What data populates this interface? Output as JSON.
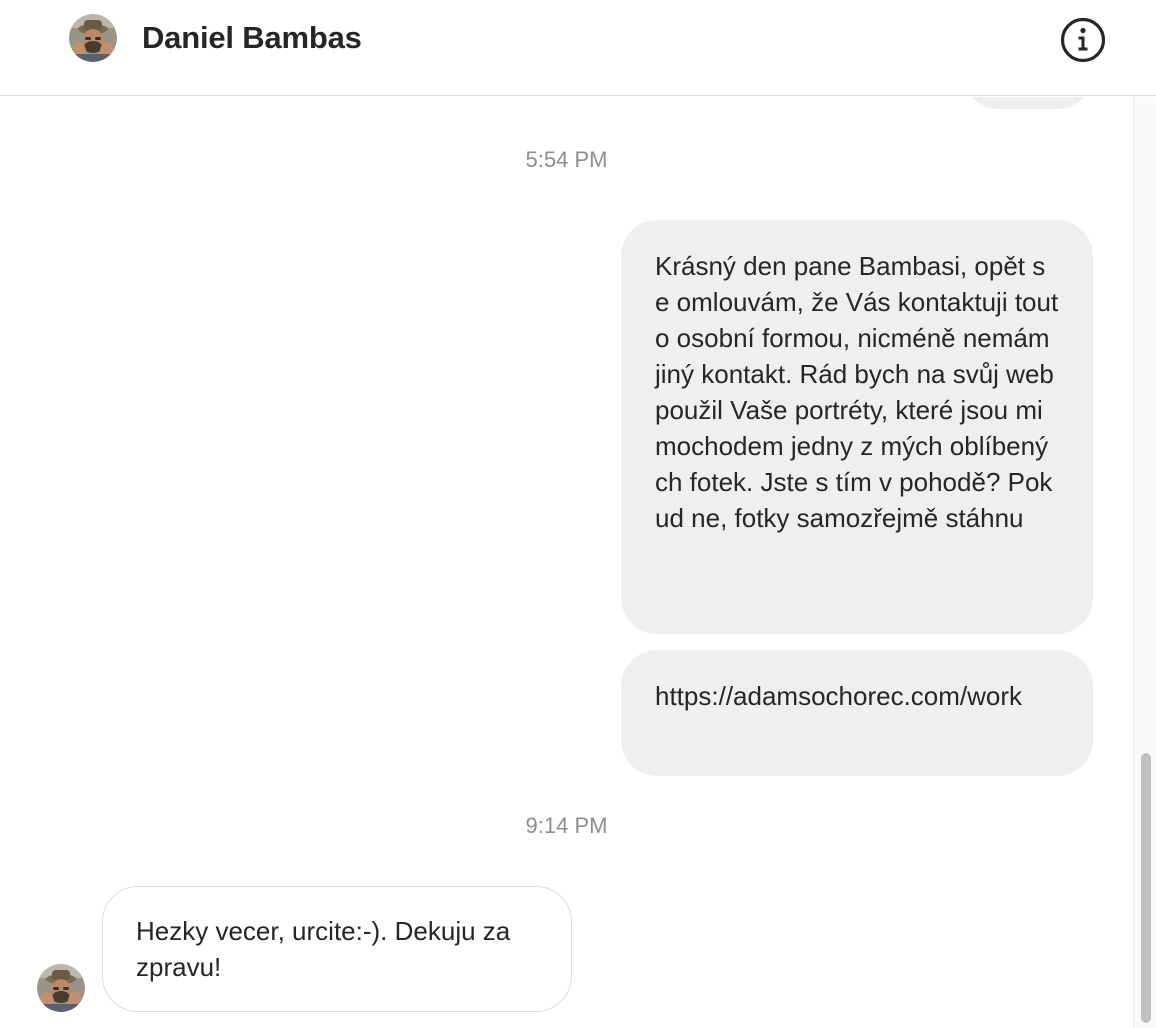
{
  "header": {
    "contact_name": "Daniel Bambas",
    "avatar_icon": "contact-avatar",
    "info_icon": "info-icon"
  },
  "thread": {
    "timestamps": [
      "5:54 PM",
      "9:14 PM"
    ],
    "messages": [
      {
        "direction": "outgoing",
        "text": "Krásný den pane Bambasi, opět se omlouvám, že Vás kontaktuji touto osobní formou, nicméně nemám jiný kontakt. Rád bych na svůj web použil Vaše portréty, které jsou mimochodem jedny z mých oblíbených fotek. Jste s tím v pohodě? Pokud ne, fotky samozřejmě stáhnu"
      },
      {
        "direction": "outgoing",
        "text": "https://adamsochorec.com/work"
      },
      {
        "direction": "incoming",
        "text": "Hezky vecer, urcite:-). Dekuju za zpravu!"
      }
    ]
  },
  "colors": {
    "outgoing_bubble": "#efefef",
    "incoming_border": "#dbdbdb",
    "timestamp": "#8e8e8e",
    "text": "#262626"
  }
}
